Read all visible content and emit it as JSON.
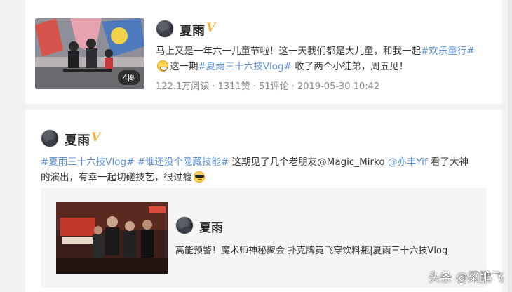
{
  "post1": {
    "author": "夏雨",
    "verified_badge": "V",
    "image_count": "4图",
    "text_prefix": "马上又是一年六一儿童节啦！这一天我们都是大儿童，和我一起",
    "tag1": "#欢乐童行#",
    "text_mid": "这一期",
    "tag2": "#夏雨三十六技Vlog#",
    "text_suffix": " 收了两个小徒弟，周五见！",
    "meta": "122.1万阅读 · 1311赞 · 51评论 · 2019-05-30 10:42"
  },
  "post2": {
    "author": "夏雨",
    "verified_badge": "V",
    "tag1": "#夏雨三十六技Vlog#",
    "tag2": "#谁还没个隐藏技能#",
    "text1": " 这期见了几个老朋友@Magic_Mirko ",
    "mention": "@亦丰Yif",
    "text2": " 看了大神",
    "text3": "的演出，有幸一起切磋技艺，很过瘾",
    "embed": {
      "author": "夏雨",
      "title": "高能预警！魔术师神秘聚会 扑克牌竟飞穿饮料瓶|夏雨三十六技Vlog"
    }
  },
  "watermark": "头条 @梁鹏飞"
}
